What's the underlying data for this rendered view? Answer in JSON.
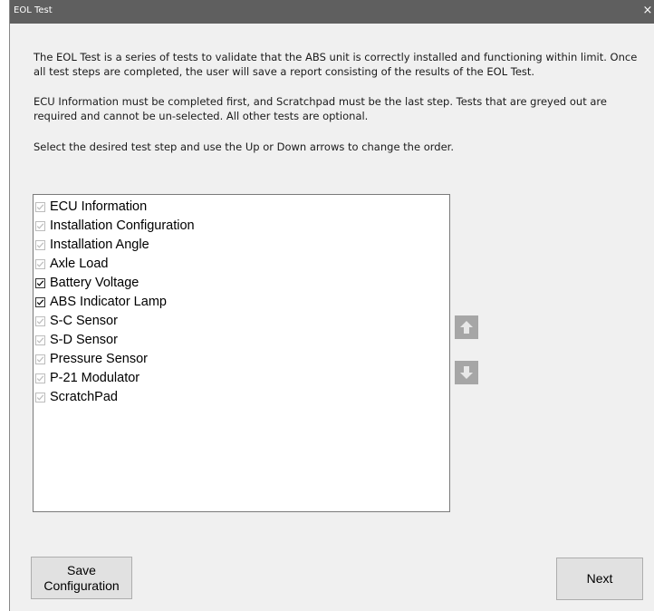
{
  "window": {
    "title": "EOL Test",
    "close_glyph": "×"
  },
  "description": {
    "p1": "The EOL Test is a series of tests to validate that the ABS unit is correctly installed and functioning within limit. Once all test steps are completed, the user will save a report consisting of the results of the EOL Test.",
    "p2": "ECU Information must be completed first, and Scratchpad must be the last step. Tests that are greyed out are required and cannot be un-selected. All other tests are optional.",
    "p3": "Select the desired test step and use the Up or Down arrows to change the order."
  },
  "test_steps": [
    {
      "label": "ECU Information",
      "checked": true,
      "required": true
    },
    {
      "label": "Installation Configuration",
      "checked": true,
      "required": true
    },
    {
      "label": "Installation Angle",
      "checked": true,
      "required": true
    },
    {
      "label": "Axle Load",
      "checked": true,
      "required": true
    },
    {
      "label": "Battery Voltage",
      "checked": true,
      "required": false
    },
    {
      "label": "ABS Indicator Lamp",
      "checked": true,
      "required": false
    },
    {
      "label": "S-C Sensor",
      "checked": true,
      "required": true
    },
    {
      "label": "S-D Sensor",
      "checked": true,
      "required": true
    },
    {
      "label": "Pressure Sensor",
      "checked": true,
      "required": true
    },
    {
      "label": "P-21 Modulator",
      "checked": true,
      "required": true
    },
    {
      "label": "ScratchPad",
      "checked": true,
      "required": true
    }
  ],
  "arrows": {
    "up_icon": "arrow-up-icon",
    "down_icon": "arrow-down-icon"
  },
  "buttons": {
    "save_line1": "Save",
    "save_line2": "Configuration",
    "next": "Next"
  },
  "colors": {
    "titlebar": "#5f5f5f",
    "check_required": "#bcbcbc",
    "check_optional": "#000000",
    "arrow_button": "#a6a6a6"
  }
}
